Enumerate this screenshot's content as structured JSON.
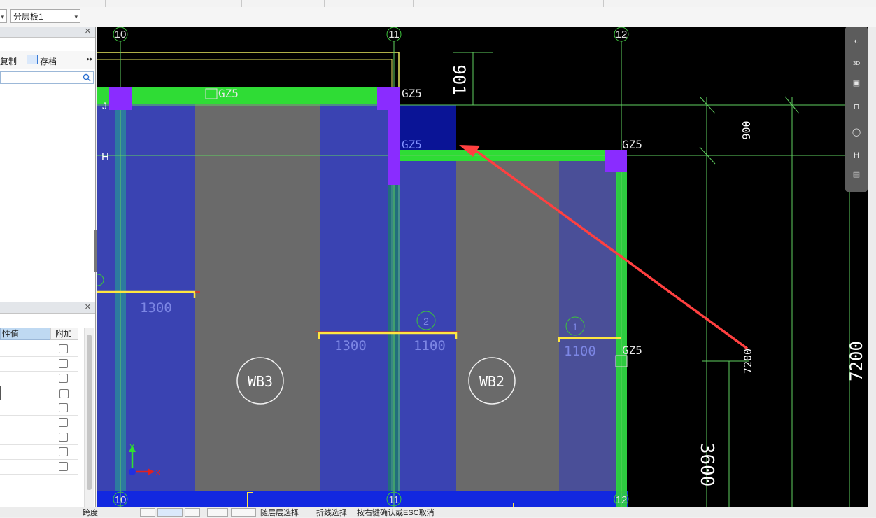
{
  "toolbar": {
    "floor_combo": "分层板1"
  },
  "left_panel": {
    "copy_label": "复制",
    "archive_label": "存档",
    "search_placeholder": "",
    "prop_header_value": "性值",
    "prop_header_extra": "附加",
    "prop_rows": [
      {
        "checked": false
      },
      {
        "checked": false
      },
      {
        "checked": false
      },
      {
        "checked": false
      },
      {
        "checked": false
      },
      {
        "checked": false
      },
      {
        "checked": false
      },
      {
        "checked": false
      },
      {
        "checked": false
      },
      {
        "checked": false
      }
    ]
  },
  "drawing": {
    "axes": {
      "a10": "10",
      "a11": "11",
      "a12": "12",
      "b10": "10",
      "b11": "11",
      "b12": "12",
      "rowJ": "J",
      "rowH": "H",
      "rowH2": "H"
    },
    "columns": {
      "gz1": "GZ5",
      "gz2": "GZ5",
      "gz3": "GZ5",
      "gz4": "GZ5",
      "gz5": "GZ5"
    },
    "dims": {
      "d901": "901",
      "d900": "900",
      "d1300a": "1300",
      "d1300b": "1300",
      "d1100a": "1100",
      "d1100b": "1100",
      "d7200a": "7200",
      "d7200b": "7200",
      "d3600": "3600",
      "m1": "1",
      "m2": "2"
    },
    "slabs": {
      "wb3": "WB3",
      "wb2": "WB2"
    },
    "ucs": {
      "y": "Y",
      "x": "X"
    },
    "colors": {
      "background": "#000000",
      "slab_blue": "#3a43b2",
      "slab_gray": "#6a6a6a",
      "wall_green": "#2fdc35",
      "column_purple": "#8a2cff",
      "annotation_arrow": "#ff4040"
    }
  },
  "navbar": {
    "h_label": "H",
    "d3_label": "3D"
  },
  "statusbar": {
    "text1": "跨度",
    "text2": "随层层选择",
    "text3": "折线选择",
    "text4": "按右键确认或ESC取消"
  }
}
